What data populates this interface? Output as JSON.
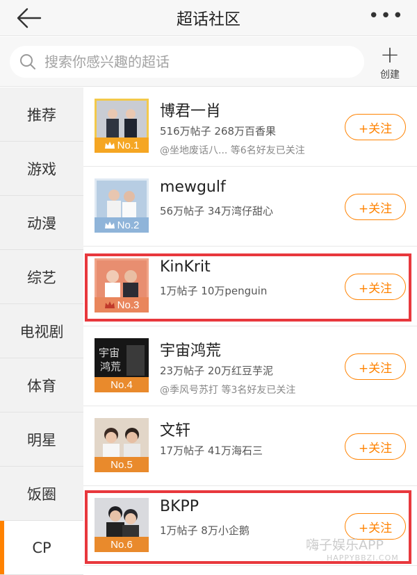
{
  "header": {
    "title": "超话社区",
    "more": "•••"
  },
  "search": {
    "placeholder": "搜索你感兴趣的超话",
    "create_label": "创建"
  },
  "sidebar": {
    "items": [
      {
        "label": "推荐"
      },
      {
        "label": "游戏"
      },
      {
        "label": "动漫"
      },
      {
        "label": "综艺"
      },
      {
        "label": "电视剧"
      },
      {
        "label": "体育"
      },
      {
        "label": "明星"
      },
      {
        "label": "饭圈"
      },
      {
        "label": "CP",
        "active": true
      }
    ]
  },
  "topics": [
    {
      "name": "博君一肖",
      "stats": "516万帖子 268万百香果",
      "friends": "@坐地废话八... 等6名好友已关注",
      "rank": "No.1",
      "rank_color": "#f5a623",
      "follow": "+关注"
    },
    {
      "name": "mewgulf",
      "stats": "56万帖子 34万湾仔甜心",
      "friends": "",
      "rank": "No.2",
      "rank_color": "#8fb4d9",
      "follow": "+关注"
    },
    {
      "name": "KinKrit",
      "stats": "1万帖子 10万penguin",
      "friends": "",
      "rank": "No.3",
      "rank_color": "#e9865c",
      "follow": "+关注"
    },
    {
      "name": "宇宙鸿荒",
      "stats": "23万帖子 20万红豆芋泥",
      "friends": "@季风号苏打 等3名好友已关注",
      "rank": "No.4",
      "rank_color": "#e98a2c",
      "follow": "+关注"
    },
    {
      "name": "文轩",
      "stats": "17万帖子 41万海石三",
      "friends": "",
      "rank": "No.5",
      "rank_color": "#e98a2c",
      "follow": "+关注"
    },
    {
      "name": "BKPP",
      "stats": "1万帖子 8万小企鹅",
      "friends": "",
      "rank": "No.6",
      "rank_color": "#e98a2c",
      "follow": "+关注"
    }
  ],
  "watermark": {
    "text": "嗨子娱乐APP",
    "sub": "HAPPYBBZI.COM"
  },
  "colors": {
    "accent": "#ff8200",
    "highlight": "#e8383d"
  }
}
